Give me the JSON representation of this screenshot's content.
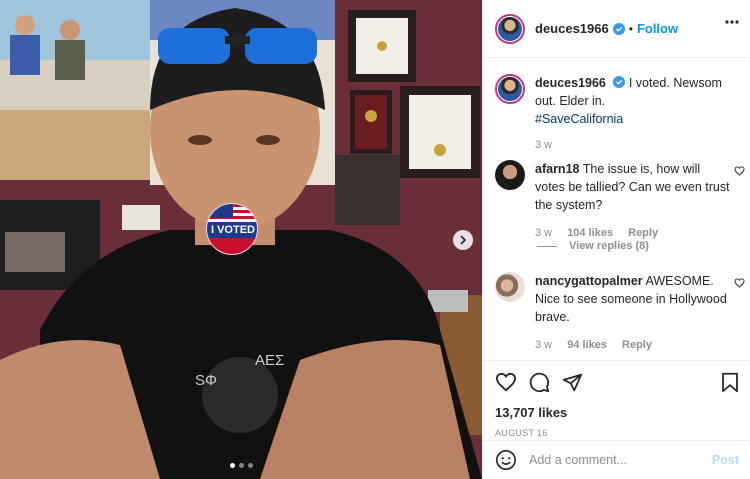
{
  "colors": {
    "link": "#0095f6",
    "hashtag": "#00376b",
    "muted": "#8e8e8e",
    "wall": "#6a2e38"
  },
  "header": {
    "username": "deuces1966",
    "separator": "•",
    "follow_label": "Follow",
    "more_icon": "more-dots-icon"
  },
  "caption": {
    "username": "deuces1966",
    "text": "I voted. Newsom out. Elder in.",
    "hashtag": "#SaveCalifornia",
    "age": "3 w"
  },
  "photo": {
    "sticker_text": "I VOTED",
    "carousel_dots": 3,
    "active_dot": 1
  },
  "comments": [
    {
      "username": "afarn18",
      "text": "The issue is, how will votes be tallied? Can we even trust the system?",
      "age": "3 w",
      "likes": "104 likes",
      "reply_label": "Reply",
      "view_replies": "View replies (8)"
    },
    {
      "username": "nancygattopalmer",
      "text": "AWESOME. Nice to see someone in Hollywood brave.",
      "age": "3 w",
      "likes": "94 likes",
      "reply_label": "Reply"
    }
  ],
  "actions": {
    "likes": "13,707 likes",
    "date": "AUGUST 16",
    "icons": [
      "heart-icon",
      "comment-icon",
      "share-icon",
      "bookmark-icon"
    ]
  },
  "add_comment": {
    "placeholder": "Add a comment...",
    "post_label": "Post",
    "emoji_icon": "emoji-icon"
  }
}
